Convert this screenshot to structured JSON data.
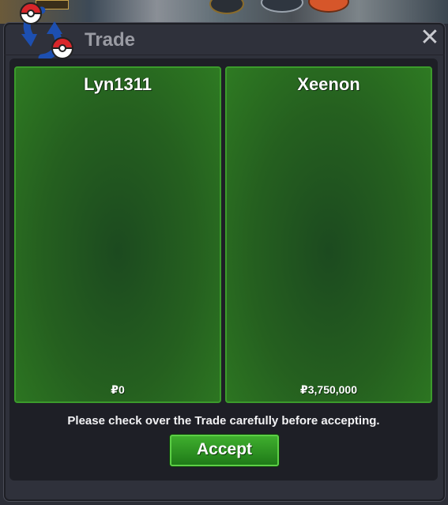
{
  "window": {
    "title": "Trade",
    "close_icon": "close-icon",
    "trade_icon": "trade-swap-icon"
  },
  "trade": {
    "left": {
      "player_name": "Lyn1311",
      "money": "₽0"
    },
    "right": {
      "player_name": "Xeenon",
      "money": "₽3,750,000"
    },
    "notice": "Please check over the Trade carefully before accepting.",
    "accept_label": "Accept"
  },
  "colors": {
    "panel_green": "#2e7a22",
    "panel_border": "#3b9b2b",
    "accept_button": "#2f9a24",
    "window_bg": "#2f313b"
  }
}
